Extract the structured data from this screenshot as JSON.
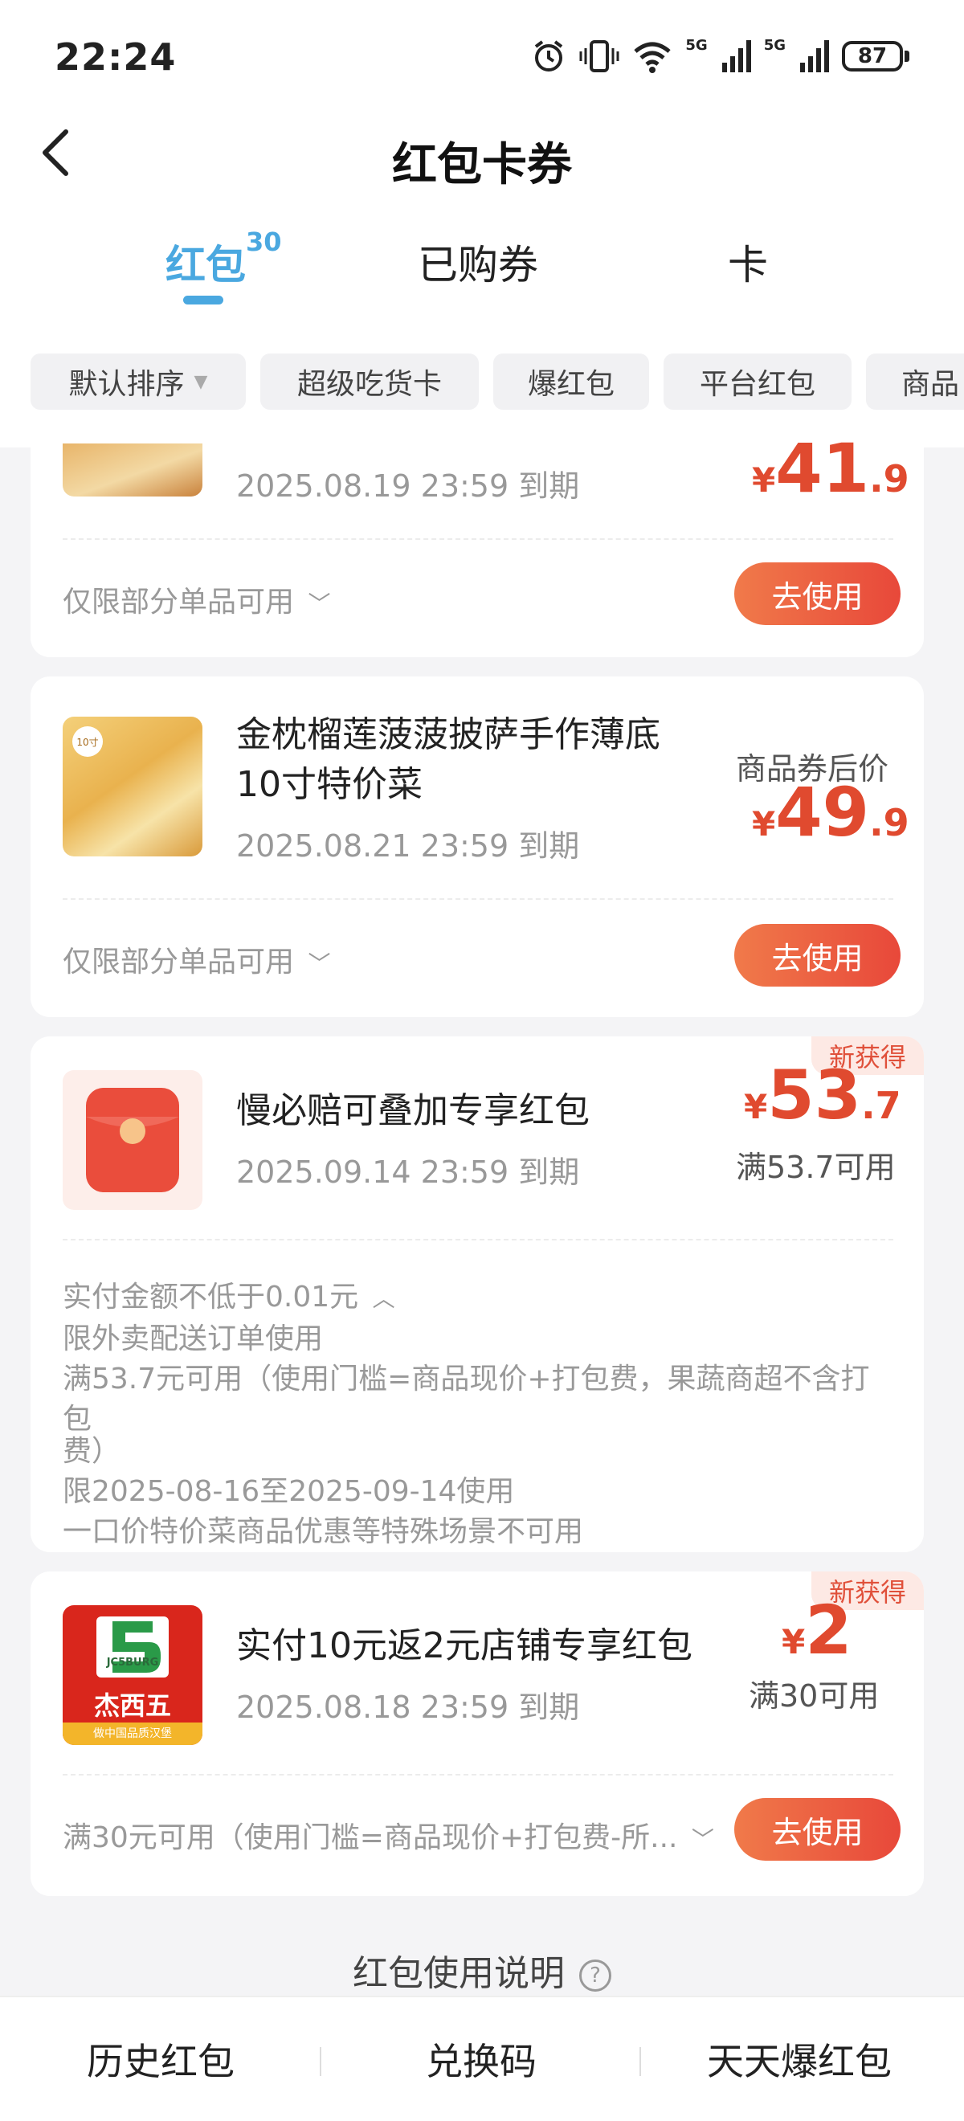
{
  "status": {
    "time": "22:24",
    "battery": "87",
    "net1": "5G",
    "net2": "5G"
  },
  "header": {
    "title": "红包卡券",
    "back_icon": "chevron-left-icon"
  },
  "tabs": [
    {
      "label": "红包",
      "badge": "30",
      "active": true
    },
    {
      "label": "已购券",
      "active": false
    },
    {
      "label": "卡",
      "active": false
    }
  ],
  "filters": [
    "默认排序",
    "超级吃货卡",
    "爆红包",
    "平台红包",
    "商品"
  ],
  "cards": [
    {
      "date": "2025.08.19 23:59 到期",
      "price_yen": "¥",
      "price_int": "41",
      "price_dec": ".9",
      "limit": "仅限部分单品可用",
      "button": "去使用"
    },
    {
      "title_line1": "金枕榴莲菠菠披萨手作薄底",
      "title_line2": "10寸特价菜",
      "date": "2025.08.21 23:59 到期",
      "price_caption": "商品券后价",
      "price_yen": "¥",
      "price_int": "49",
      "price_dec": ".9",
      "thumb_label": "10寸",
      "limit": "仅限部分单品可用",
      "button": "去使用"
    },
    {
      "badge": "新获得",
      "title": "慢必赔可叠加专享红包",
      "date": "2025.09.14 23:59 到期",
      "price_yen": "¥",
      "price_int": "53",
      "price_dec": ".7",
      "price_sub": "满53.7可用",
      "details": [
        "实付金额不低于0.01元",
        "限外卖配送订单使用",
        "满53.7元可用（使用门槛=商品现价+打包费，果蔬商超不含打包",
        "费）",
        "限2025-08-16至2025-09-14使用",
        "一口价特价菜商品优惠等特殊场景不可用"
      ]
    },
    {
      "badge": "新获得",
      "title": "实付10元返2元店铺专享红包",
      "date": "2025.08.18 23:59 到期",
      "price_yen": "¥",
      "price_int": "2",
      "price_sub": "满30可用",
      "logo_brand": "JC5BURG",
      "logo_name": "杰西五",
      "logo_slogan": "做中国品质汉堡",
      "limit": "满30元可用（使用门槛=商品现价+打包费-所...",
      "button": "去使用"
    }
  ],
  "usage_link": "红包使用说明",
  "bottom": [
    "历史红包",
    "兑换码",
    "天天爆红包"
  ]
}
